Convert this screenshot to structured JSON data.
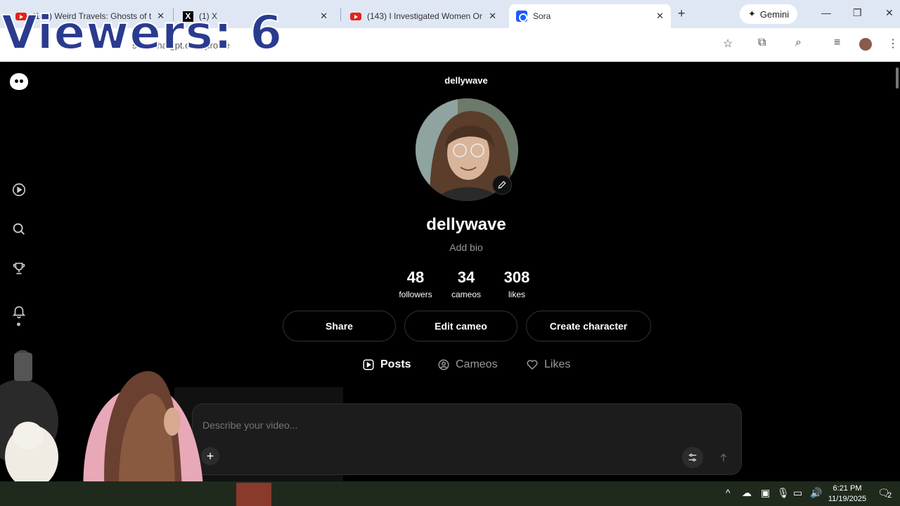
{
  "browser": {
    "tabs": [
      {
        "title": "(143) Weird Travels: Ghosts of t",
        "favicon": "youtube"
      },
      {
        "title": "(1) X",
        "favicon": "x"
      },
      {
        "title": "(143) I Investigated Women Or",
        "favicon": "youtube"
      },
      {
        "title": "Sora",
        "favicon": "sora",
        "active": true
      }
    ],
    "gemini_label": "Gemini",
    "address": "sora.chatgpt.com/profile"
  },
  "overlay": {
    "viewers_text": "Viewers: 6"
  },
  "profile": {
    "handle_header": "dellywave",
    "username": "dellywave",
    "bio_placeholder": "Add bio",
    "stats": [
      {
        "value": "48",
        "label": "followers"
      },
      {
        "value": "34",
        "label": "cameos"
      },
      {
        "value": "308",
        "label": "likes"
      }
    ],
    "buttons": {
      "share": "Share",
      "edit_cameo": "Edit cameo",
      "create_character": "Create character"
    },
    "tabs": {
      "posts": "Posts",
      "cameos": "Cameos",
      "likes": "Likes"
    }
  },
  "composer": {
    "placeholder": "Describe your video..."
  },
  "taskbar": {
    "time": "6:21 PM",
    "date": "11/19/2025",
    "notifications": "2"
  },
  "colors": {
    "background": "#000000",
    "tab_bar": "#dfe7f5",
    "composer": "#1c1c1c",
    "viewers_text": "#2a3b8f"
  }
}
